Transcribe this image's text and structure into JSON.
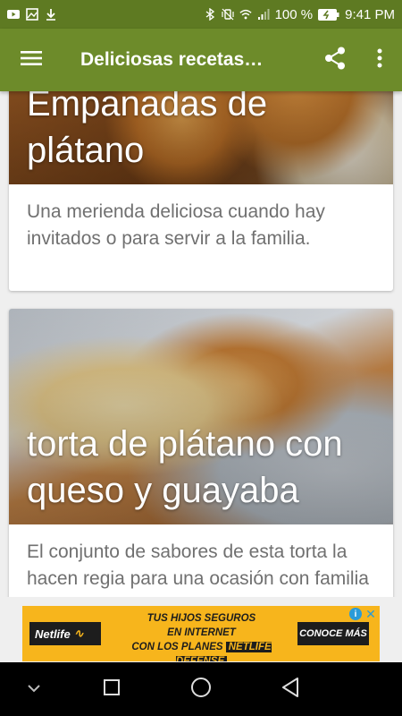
{
  "status_bar": {
    "battery": "100 %",
    "time": "9:41 PM",
    "left_icons": [
      "youtube-icon",
      "gallery-icon",
      "download-icon"
    ],
    "right_icons": [
      "bluetooth-icon",
      "vibrate-icon",
      "wifi-icon",
      "signal-icon",
      "battery-icon"
    ]
  },
  "app_bar": {
    "title": "Deliciosas recetas…",
    "color": "#6d8b2a"
  },
  "cards": [
    {
      "title": "Empanadas de plátano",
      "description": "Una merienda deliciosa cuando hay invitados o para servir a la familia."
    },
    {
      "title": "torta de plátano con queso y guayaba",
      "description": "El conjunto de sabores de esta torta la hacen regia para una ocasión con familia y amigos."
    }
  ],
  "ad": {
    "logo": "Netlife",
    "line1": "TUS HIJOS SEGUROS",
    "line2": "EN INTERNET",
    "line3": "CON LOS PLANES",
    "line3_highlight": "NETLIFE DEFENSE",
    "cta": "CONOCE MÁS",
    "info": "i",
    "close": "✕"
  },
  "nav_bar": {
    "buttons": [
      "chevron-down-icon",
      "recents-icon",
      "home-icon",
      "back-icon"
    ]
  }
}
